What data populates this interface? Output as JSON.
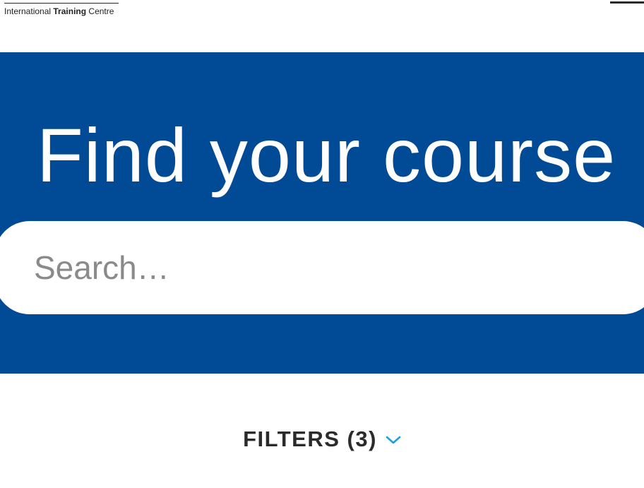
{
  "header": {
    "logo": {
      "part1": "International",
      "part2": "Training",
      "part3": "Centre"
    }
  },
  "hero": {
    "title": "Find your course",
    "background_color": "#004a96"
  },
  "search": {
    "placeholder": "Search…",
    "value": ""
  },
  "filters": {
    "label": "FILTERS (3)",
    "icon": "chevron-down-icon",
    "icon_color": "#1aa0e6"
  }
}
